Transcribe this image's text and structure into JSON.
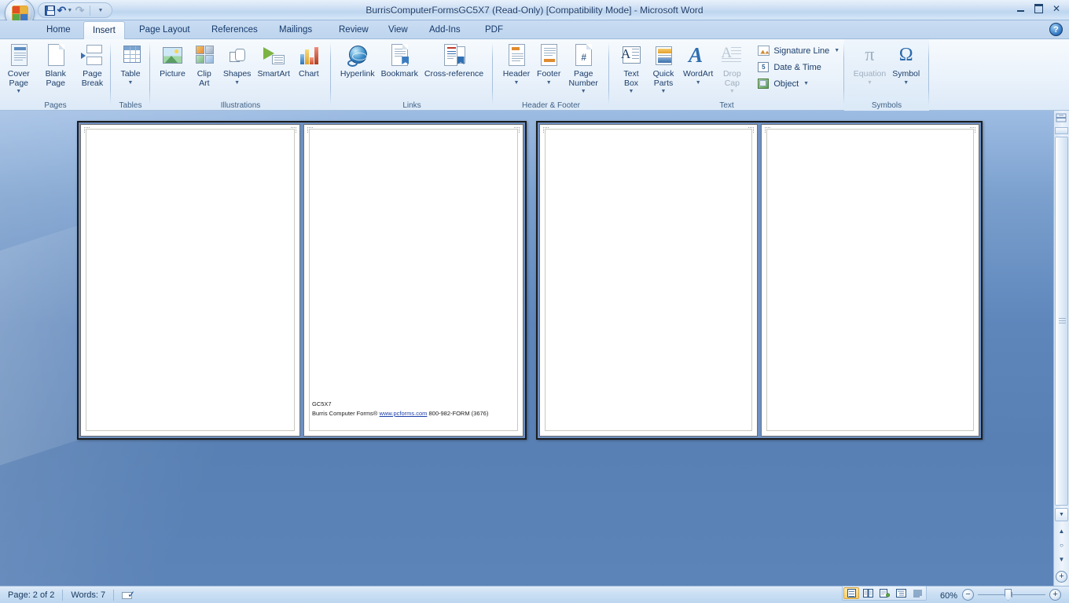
{
  "window": {
    "title": "BurrisComputerFormsGC5X7 (Read-Only) [Compatibility Mode] - Microsoft Word",
    "minimize_label": "Minimize",
    "restore_label": "Restore Down",
    "close_label": "✕",
    "help_label": "?"
  },
  "quick_access": {
    "office_button": "Office Button",
    "save": "Save",
    "undo": "↶",
    "undo_dd": "▼",
    "redo": "↷",
    "customize": "▼"
  },
  "tabs": [
    {
      "label": "Home",
      "active": false
    },
    {
      "label": "Insert",
      "active": true
    },
    {
      "label": "Page Layout",
      "active": false
    },
    {
      "label": "References",
      "active": false
    },
    {
      "label": "Mailings",
      "active": false
    },
    {
      "label": "Review",
      "active": false
    },
    {
      "label": "View",
      "active": false
    },
    {
      "label": "Add-Ins",
      "active": false
    },
    {
      "label": "PDF",
      "active": false
    }
  ],
  "ribbon": {
    "groups": [
      {
        "name": "Pages",
        "label": "Pages",
        "items": [
          {
            "label": "Cover Page",
            "icon": "cover-page-icon",
            "dropdown": true,
            "disabled": false
          },
          {
            "label": "Blank Page",
            "icon": "blank-page-icon",
            "dropdown": false,
            "disabled": false
          },
          {
            "label": "Page Break",
            "icon": "page-break-icon",
            "dropdown": false,
            "disabled": false
          }
        ]
      },
      {
        "name": "Tables",
        "label": "Tables",
        "items": [
          {
            "label": "Table",
            "icon": "table-icon",
            "dropdown": true,
            "disabled": false
          }
        ]
      },
      {
        "name": "Illustrations",
        "label": "Illustrations",
        "items": [
          {
            "label": "Picture",
            "icon": "picture-icon",
            "dropdown": false,
            "disabled": false
          },
          {
            "label": "Clip Art",
            "icon": "clip-art-icon",
            "dropdown": false,
            "disabled": false
          },
          {
            "label": "Shapes",
            "icon": "shapes-icon",
            "dropdown": true,
            "disabled": false
          },
          {
            "label": "SmartArt",
            "icon": "smartart-icon",
            "dropdown": false,
            "disabled": false
          },
          {
            "label": "Chart",
            "icon": "chart-icon",
            "dropdown": false,
            "disabled": false
          }
        ]
      },
      {
        "name": "Links",
        "label": "Links",
        "items": [
          {
            "label": "Hyperlink",
            "icon": "hyperlink-icon",
            "dropdown": false,
            "disabled": false
          },
          {
            "label": "Bookmark",
            "icon": "bookmark-icon",
            "dropdown": false,
            "disabled": false
          },
          {
            "label": "Cross-reference",
            "icon": "cross-reference-icon",
            "dropdown": false,
            "disabled": false
          }
        ]
      },
      {
        "name": "Header & Footer",
        "label": "Header & Footer",
        "items": [
          {
            "label": "Header",
            "icon": "header-icon",
            "dropdown": true,
            "disabled": false
          },
          {
            "label": "Footer",
            "icon": "footer-icon",
            "dropdown": true,
            "disabled": false
          },
          {
            "label": "Page Number",
            "icon": "page-number-icon",
            "dropdown": true,
            "disabled": false
          }
        ]
      },
      {
        "name": "Text",
        "label": "Text",
        "items": [
          {
            "label": "Text Box",
            "icon": "text-box-icon",
            "dropdown": true,
            "disabled": false
          },
          {
            "label": "Quick Parts",
            "icon": "quick-parts-icon",
            "dropdown": true,
            "disabled": false
          },
          {
            "label": "WordArt",
            "icon": "wordart-icon",
            "dropdown": true,
            "disabled": false
          },
          {
            "label": "Drop Cap",
            "icon": "drop-cap-icon",
            "dropdown": true,
            "disabled": true
          }
        ],
        "small_items": [
          {
            "label": "Signature Line",
            "icon": "signature-line-icon",
            "dropdown": true,
            "disabled": false
          },
          {
            "label": "Date & Time",
            "icon": "date-time-icon",
            "dropdown": false,
            "disabled": false
          },
          {
            "label": "Object",
            "icon": "object-icon",
            "dropdown": true,
            "disabled": false
          }
        ]
      },
      {
        "name": "Symbols",
        "label": "Symbols",
        "items": [
          {
            "label": "Equation",
            "icon": "equation-icon",
            "glyph": "π",
            "dropdown": true,
            "disabled": true
          },
          {
            "label": "Symbol",
            "icon": "symbol-icon",
            "glyph": "Ω",
            "dropdown": true,
            "disabled": false
          }
        ]
      }
    ]
  },
  "document": {
    "pages": [
      {
        "id": "page-1",
        "content": null
      },
      {
        "id": "page-2",
        "content": {
          "line1": "GC5X7",
          "line2_prefix": "Burris Computer Forms® ",
          "line2_link": "www.pcforms.com",
          "line2_suffix": " 800-982-FORM (3676)"
        }
      },
      {
        "id": "page-3",
        "content": null
      },
      {
        "id": "page-4",
        "content": null
      }
    ]
  },
  "statusbar": {
    "page_label": "Page: 2 of 2",
    "words_label": "Words: 7",
    "proofing_label": "Proofing errors",
    "zoom_label": "60%",
    "zoom_out": "−",
    "zoom_in": "+",
    "views": [
      {
        "name": "print-layout",
        "label": "Print Layout",
        "active": true
      },
      {
        "name": "full-screen-reading",
        "label": "Full Screen Reading",
        "active": false
      },
      {
        "name": "web-layout",
        "label": "Web Layout",
        "active": false
      },
      {
        "name": "outline",
        "label": "Outline",
        "active": false
      },
      {
        "name": "draft",
        "label": "Draft",
        "active": false
      }
    ]
  },
  "scrollbar": {
    "split_label": "Split",
    "up_label": "▲",
    "down_label": "▼",
    "prev_page_label": "▲",
    "select_browse_label": "○",
    "next_page_label": "▼"
  },
  "colors": {
    "workspace_blue": "#5880b4",
    "ribbon_blue": "#cfe0f4",
    "accent_text": "#15396b",
    "link_blue": "#1b3fa8"
  }
}
